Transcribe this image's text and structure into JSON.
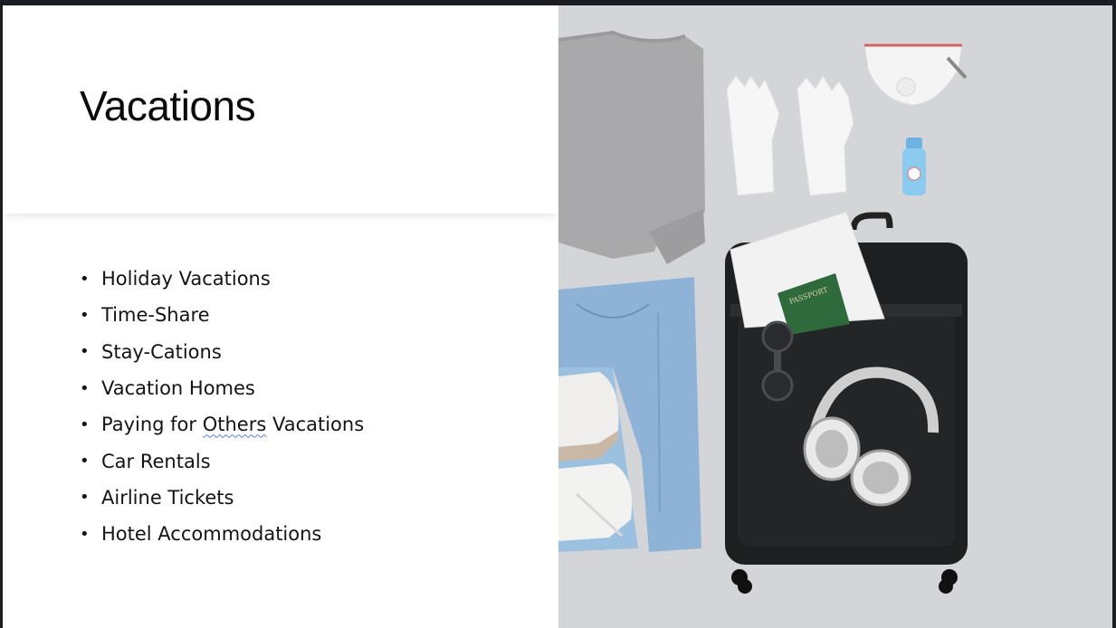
{
  "slide": {
    "title": "Vacations",
    "bullets": [
      {
        "before": "Holiday Vacations",
        "marked": "",
        "after": ""
      },
      {
        "before": "Time-Share",
        "marked": "",
        "after": ""
      },
      {
        "before": "Stay-Cations",
        "marked": "",
        "after": ""
      },
      {
        "before": "Vacation Homes",
        "marked": "",
        "after": ""
      },
      {
        "before": "Paying for ",
        "marked": "Others",
        "after": " Vacations"
      },
      {
        "before": "Car Rentals",
        "marked": "",
        "after": ""
      },
      {
        "before": "Airline Tickets",
        "marked": "",
        "after": ""
      },
      {
        "before": "Hotel Accommodations",
        "marked": "",
        "after": ""
      }
    ],
    "bullet_glyph": "•"
  },
  "image": {
    "passport_text": "PASSPORT"
  },
  "colors": {
    "photo_bg": "#d4d5d8",
    "suitcase": "#1e1f21",
    "passport": "#2f6a3d",
    "denim": "#8fb3d6",
    "spell_underline": "#5a7bd6"
  }
}
